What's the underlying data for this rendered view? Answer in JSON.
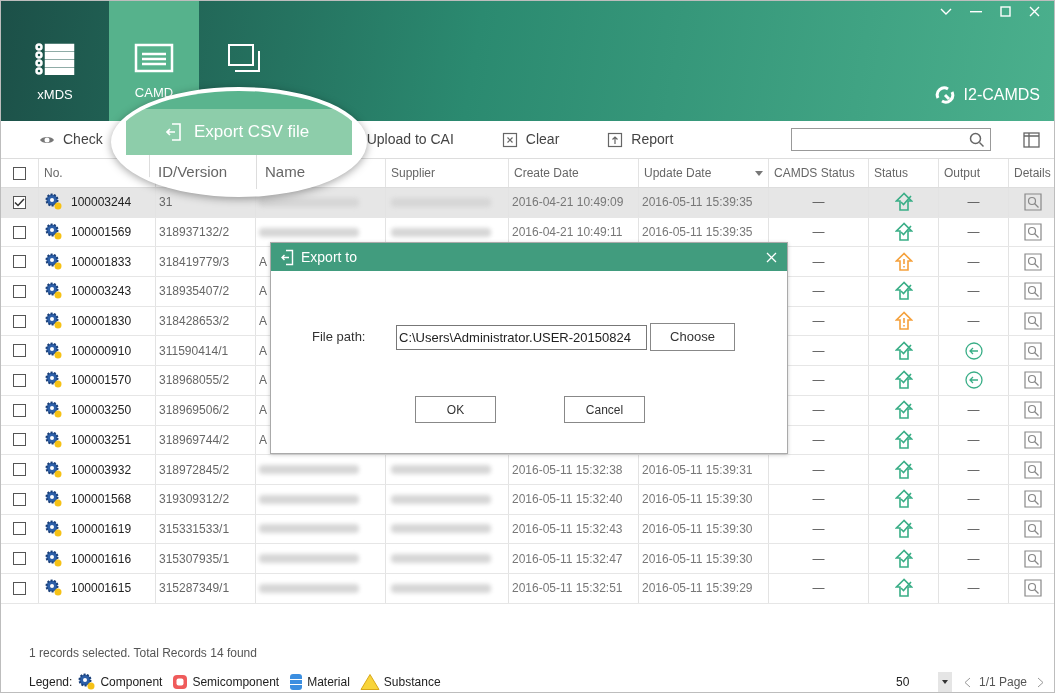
{
  "window": {
    "app_name": "I2-CAMDS"
  },
  "nav_tabs": [
    {
      "label": "xMDS",
      "selected": false
    },
    {
      "label": "CAMD",
      "selected": true
    },
    {
      "selected": false
    }
  ],
  "toolbar": [
    {
      "label": "Check"
    },
    {
      "label": "Upload to CAI"
    },
    {
      "label": "Clear"
    },
    {
      "label": "Report"
    }
  ],
  "magnifier": {
    "action": "Export CSV file",
    "columns": [
      "ID/Version",
      "Name"
    ]
  },
  "table": {
    "select_all": {
      "checked": false
    },
    "first_column": "No.",
    "columns": [
      {
        "label": "Supplier",
        "sorted": false
      },
      {
        "label": "Create Date",
        "sorted": false
      },
      {
        "label": "Update Date",
        "sorted": true
      },
      {
        "label": "CAMDS Status",
        "sorted": false
      },
      {
        "label": "Status",
        "sorted": false
      },
      {
        "label": "Output",
        "sorted": false
      },
      {
        "label": "Details",
        "sorted": false
      }
    ],
    "rows": [
      {
        "selected": true,
        "no": "100003244",
        "id": "31",
        "create": "2016-04-21 10:49:09",
        "update": "2016-05-11 15:39:35",
        "camds": "—",
        "status": {
          "kind": "ok"
        },
        "output": {
          "kind": "text",
          "text": "—"
        }
      },
      {
        "selected": false,
        "no": "100001569",
        "id": "318937132/2",
        "create": "2016-04-21 10:49:11",
        "update": "2016-05-11 15:39:35",
        "camds": "—",
        "status": {
          "kind": "ok"
        },
        "output": {
          "kind": "text",
          "text": "—"
        }
      },
      {
        "selected": false,
        "no": "100001833",
        "id": "318419779/3",
        "name": "A",
        "camds": "—",
        "status": {
          "kind": "warn"
        },
        "output": {
          "kind": "text",
          "text": "—"
        }
      },
      {
        "selected": false,
        "no": "100003243",
        "id": "318935407/2",
        "name": "A",
        "camds": "—",
        "status": {
          "kind": "ok"
        },
        "output": {
          "kind": "text",
          "text": "—"
        }
      },
      {
        "selected": false,
        "no": "100001830",
        "id": "318428653/2",
        "name": "A",
        "camds": "—",
        "status": {
          "kind": "warn"
        },
        "output": {
          "kind": "text",
          "text": "—"
        }
      },
      {
        "selected": false,
        "no": "100000910",
        "id": "311590414/1",
        "name": "A",
        "camds": "—",
        "status": {
          "kind": "ok"
        },
        "output": {
          "kind": "arrow"
        }
      },
      {
        "selected": false,
        "no": "100001570",
        "id": "318968055/2",
        "name": "A",
        "camds": "—",
        "status": {
          "kind": "ok"
        },
        "output": {
          "kind": "arrow"
        }
      },
      {
        "selected": false,
        "no": "100003250",
        "id": "318969506/2",
        "name": "A",
        "camds": "—",
        "status": {
          "kind": "ok"
        },
        "output": {
          "kind": "text",
          "text": "—"
        }
      },
      {
        "selected": false,
        "no": "100003251",
        "id": "318969744/2",
        "name": "A",
        "camds": "—",
        "status": {
          "kind": "ok"
        },
        "output": {
          "kind": "text",
          "text": "—"
        }
      },
      {
        "selected": false,
        "no": "100003932",
        "id": "318972845/2",
        "create": "2016-05-11 15:32:38",
        "update": "2016-05-11 15:39:31",
        "camds": "—",
        "status": {
          "kind": "ok"
        },
        "output": {
          "kind": "text",
          "text": "—"
        }
      },
      {
        "selected": false,
        "no": "100001568",
        "id": "319309312/2",
        "create": "2016-05-11 15:32:40",
        "update": "2016-05-11 15:39:30",
        "camds": "—",
        "status": {
          "kind": "ok"
        },
        "output": {
          "kind": "text",
          "text": "—"
        }
      },
      {
        "selected": false,
        "no": "100001619",
        "id": "315331533/1",
        "create": "2016-05-11 15:32:43",
        "update": "2016-05-11 15:39:30",
        "camds": "—",
        "status": {
          "kind": "ok"
        },
        "output": {
          "kind": "text",
          "text": "—"
        }
      },
      {
        "selected": false,
        "no": "100001616",
        "id": "315307935/1",
        "create": "2016-05-11 15:32:47",
        "update": "2016-05-11 15:39:30",
        "camds": "—",
        "status": {
          "kind": "ok"
        },
        "output": {
          "kind": "text",
          "text": "—"
        }
      },
      {
        "selected": false,
        "no": "100001615",
        "id": "315287349/1",
        "create": "2016-05-11 15:32:51",
        "update": "2016-05-11 15:39:29",
        "camds": "—",
        "status": {
          "kind": "ok"
        },
        "output": {
          "kind": "text",
          "text": "—"
        }
      }
    ]
  },
  "dialog": {
    "title": "Export to",
    "label": "File path:",
    "value": "C:\\Users\\Administrator.USER-20150824",
    "buttons": [
      "Choose",
      "OK",
      "Cancel"
    ]
  },
  "status_bar": {
    "summary": "1 records selected. Total Records 14 found",
    "legend_label": "Legend:",
    "legend": [
      {
        "kind": "component",
        "label": "Component"
      },
      {
        "kind": "semicomponent",
        "label": "Semicomponent"
      },
      {
        "kind": "material",
        "label": "Material"
      },
      {
        "kind": "substance",
        "label": "Substance"
      }
    ],
    "page_size": "50",
    "page": "1/1 Page"
  }
}
